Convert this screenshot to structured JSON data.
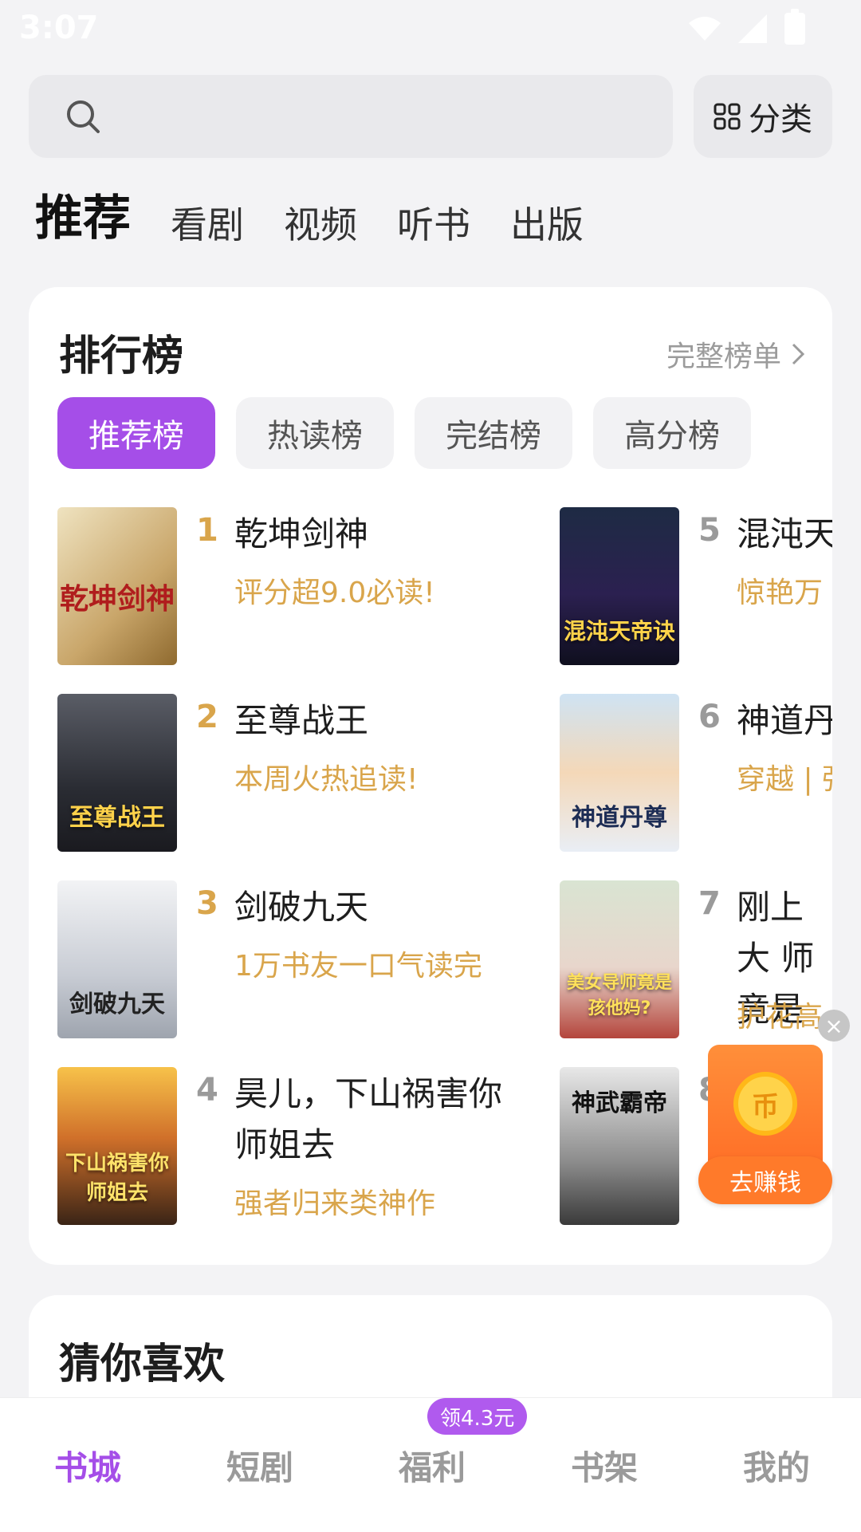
{
  "status": {
    "time": "3:07"
  },
  "search": {
    "category_label": "分类"
  },
  "top_tabs": [
    "推荐",
    "看剧",
    "视频",
    "听书",
    "出版"
  ],
  "ranking": {
    "title": "排行榜",
    "more": "完整榜单",
    "chips": [
      "推荐榜",
      "热读榜",
      "完结榜",
      "高分榜"
    ],
    "books": [
      {
        "rank": "1",
        "title": "乾坤剑神",
        "desc": "评分超9.0必读!",
        "cover_text": "乾坤剑神"
      },
      {
        "rank": "2",
        "title": "至尊战王",
        "desc": "本周火热追读!",
        "cover_text": "至尊战王"
      },
      {
        "rank": "3",
        "title": "剑破九天",
        "desc": "1万书友一口气读完",
        "cover_text": "剑破九天"
      },
      {
        "rank": "4",
        "title": "昊儿，下山祸害你师姐去",
        "desc": "强者归来类神作",
        "cover_text": "下山祸害你师姐去"
      },
      {
        "rank": "5",
        "title": "混沌天",
        "desc": "惊艳万",
        "cover_text": "混沌天帝诀"
      },
      {
        "rank": "6",
        "title": "神道丹",
        "desc": "穿越 | 强",
        "cover_text": "神道丹尊"
      },
      {
        "rank": "7",
        "title": "刚上大 师竟是",
        "desc": "护花高",
        "cover_text": "美女导师竟是孩他妈?"
      },
      {
        "rank": "8",
        "title": "",
        "desc": "",
        "cover_text": "神武霸帝"
      }
    ]
  },
  "guess": {
    "title": "猜你喜欢"
  },
  "floater": {
    "button": "去赚钱",
    "coin": "币"
  },
  "bottom_nav": {
    "items": [
      "书城",
      "短剧",
      "福利",
      "书架",
      "我的"
    ],
    "badge": "领4.3元"
  },
  "colors": {
    "accent": "#a54ee8",
    "gold": "#d9a54b"
  }
}
